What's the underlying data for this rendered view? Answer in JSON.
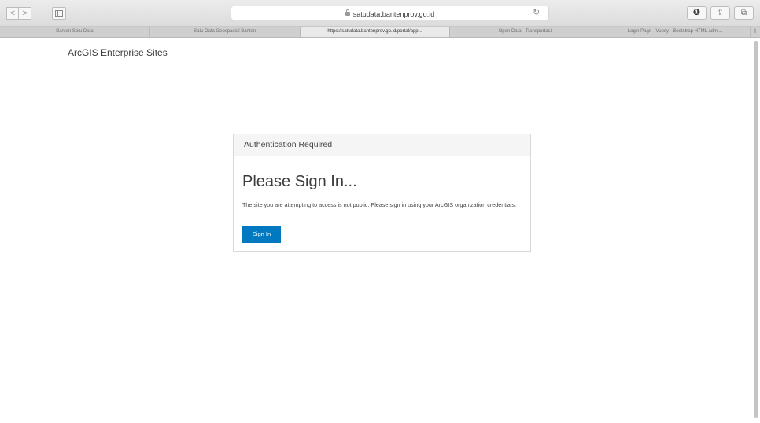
{
  "browser": {
    "nav": {
      "back_icon": "<",
      "forward_icon": ">"
    },
    "url": "satudata.bantenprov.go.id",
    "reload_icon": "↻",
    "buttons": {
      "extension_icon": "❶",
      "share_icon": "⇪",
      "tabs_icon": "⧉"
    },
    "tabs": [
      {
        "label": "Banten Satu Data"
      },
      {
        "label": "Satu Data Geospasial Banten"
      },
      {
        "label": "https://satudata.bantenprov.go.id/portal/app..."
      },
      {
        "label": "Open Data - Transportasi"
      },
      {
        "label": "Login Page - Vuesy - Bootstrap HTML admi..."
      }
    ],
    "new_tab_icon": "+"
  },
  "page": {
    "site_title": "ArcGIS Enterprise Sites",
    "auth": {
      "header": "Authentication Required",
      "heading": "Please Sign In...",
      "message": "The site you are attempting to access is not public. Please sign in using your ArcGIS organization credentials.",
      "button": "Sign In"
    }
  },
  "colors": {
    "accent": "#0079c1"
  }
}
